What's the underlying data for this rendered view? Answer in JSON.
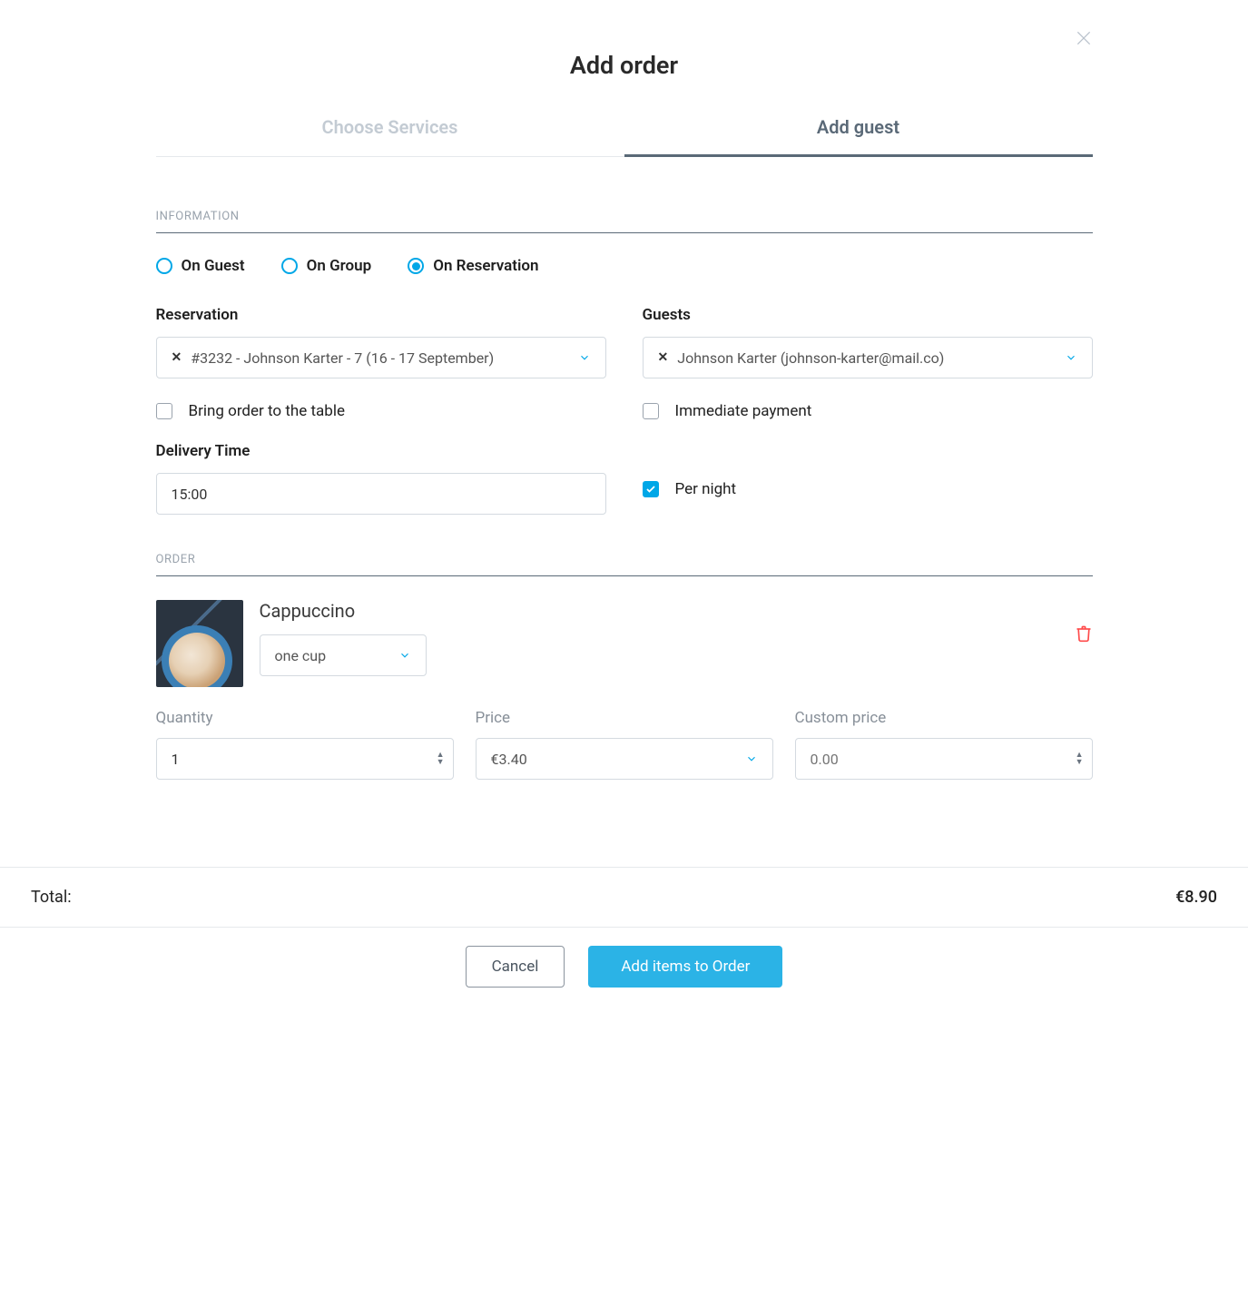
{
  "title": "Add order",
  "tabs": {
    "choose": "Choose Services",
    "addGuest": "Add guest"
  },
  "sections": {
    "information": "INFORMATION",
    "order": "ORDER"
  },
  "radios": {
    "onGuest": "On Guest",
    "onGroup": "On Group",
    "onReservation": "On Reservation",
    "selected": "onReservation"
  },
  "fields": {
    "reservation": {
      "label": "Reservation",
      "value": "#3232 - Johnson Karter - 7 (16 - 17 September)"
    },
    "guests": {
      "label": "Guests",
      "value": "Johnson Karter (johnson-karter@mail.co)"
    },
    "bringToTable": {
      "label": "Bring order to the table",
      "checked": false
    },
    "immediatePayment": {
      "label": "Immediate payment",
      "checked": false
    },
    "deliveryTime": {
      "label": "Delivery Time",
      "value": "15:00"
    },
    "perNight": {
      "label": "Per night",
      "checked": true
    }
  },
  "orderItem": {
    "name": "Cappuccino",
    "variant": "one cup",
    "quantity": {
      "label": "Quantity",
      "value": "1"
    },
    "price": {
      "label": "Price",
      "value": "€3.40"
    },
    "customPrice": {
      "label": "Custom price",
      "placeholder": "0.00"
    }
  },
  "total": {
    "label": "Total:",
    "value": "€8.90"
  },
  "actions": {
    "cancel": "Cancel",
    "addItems": "Add items to Order"
  }
}
